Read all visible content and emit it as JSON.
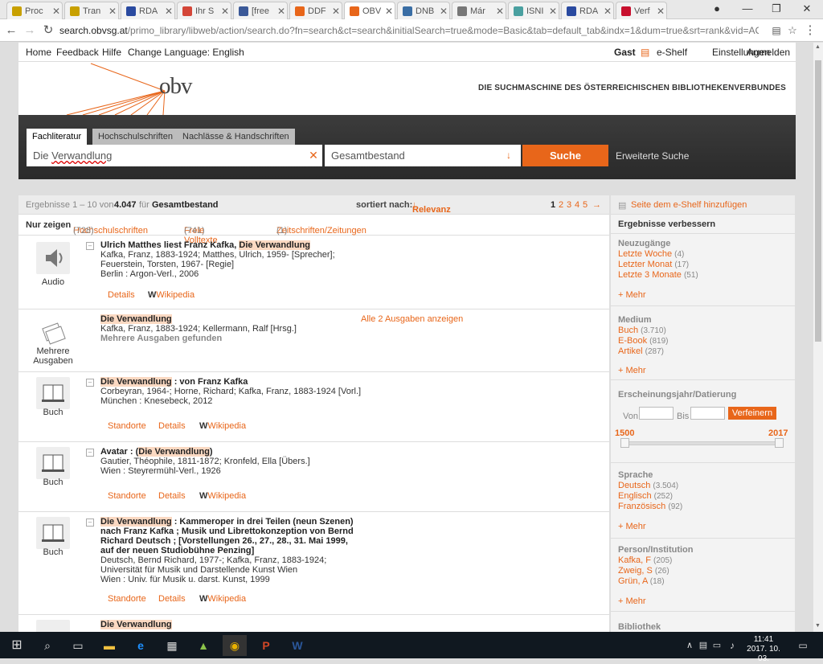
{
  "browser": {
    "tabs": [
      {
        "label": "Proc",
        "color": "#c8a000"
      },
      {
        "label": "Tran",
        "color": "#c8a000"
      },
      {
        "label": "RDA",
        "color": "#2a4aa0"
      },
      {
        "label": "Ihr S",
        "color": "#d44638"
      },
      {
        "label": "[free",
        "color": "#3b5998"
      },
      {
        "label": "DDF",
        "color": "#e8661a"
      },
      {
        "label": "OBV",
        "color": "#e8661a"
      },
      {
        "label": "DNB",
        "color": "#3a6ea5"
      },
      {
        "label": "Már",
        "color": "#777777"
      },
      {
        "label": "ISNI",
        "color": "#4aa0a0"
      },
      {
        "label": "RDA",
        "color": "#2a4aa0"
      },
      {
        "label": "Verf",
        "color": "#c8102e"
      }
    ],
    "close_glyph": "✕",
    "url_host": "search.obvsg.at",
    "url_path": "/primo_library/libweb/action/search.do?fn=search&ct=search&initialSearch=true&mode=Basic&tab=default_tab&indx=1&dum=true&srt=rank&vid=ACC..."
  },
  "topnav": {
    "home": "Home",
    "feedback": "Feedback",
    "help": "Hilfe",
    "lang": "Change Language: English",
    "guest": "Gast",
    "eshelf": "e-Shelf",
    "settings": "Einstellungen",
    "login": "Anmelden"
  },
  "banner": {
    "logo": "obv",
    "tagline": "DIE SUCHMASCHINE DES ÖSTERREICHISCHEN BIBLIOTHEKENVERBUNDES"
  },
  "search": {
    "tabs": [
      "Fachliteratur",
      "Hochschulschriften",
      "Nachlässe & Handschriften"
    ],
    "query_prefix": "Die ",
    "query_word": "Verwandlung",
    "clear_glyph": "✕",
    "scope": "Gesamtbestand",
    "scope_arrow": "↓",
    "button": "Suche",
    "advanced": "Erweiterte Suche"
  },
  "results_header": {
    "range": "Ergebnisse 1 – 10 von",
    "total": "4.047",
    "for": "für",
    "scope": "Gesamtbestand",
    "sort_label": "sortiert nach:",
    "sort_value": "Relevanz",
    "pages": [
      "1",
      "2",
      "3",
      "4",
      "5"
    ],
    "next": "→"
  },
  "filters": {
    "label": "Nur zeigen",
    "items": [
      {
        "name": "Hochschulschriften",
        "count": "(728)"
      },
      {
        "name": "Freie Volltexte",
        "count": "(741)"
      },
      {
        "name": "Zeitschriften/Zeitungen",
        "count": "(1)"
      }
    ]
  },
  "records": [
    {
      "type": "Audio",
      "title_pre": "Ulrich Matthes liest Franz Kafka, ",
      "title_hl": "Die Verwandlung",
      "title_post": "",
      "lines": [
        "Kafka, Franz, 1883-1924; Matthes, Ulrich, 1959- [Sprecher];",
        "Feuerstein, Torsten, 1967- [Regie]",
        "Berlin : Argon-Verl., 2006"
      ],
      "links": [
        "Details",
        "Wikipedia"
      ]
    },
    {
      "type": "Mehrere Ausgaben",
      "title_pre": "",
      "title_hl": "Die Verwandlung",
      "title_post": "",
      "lines": [
        "Kafka, Franz, 1883-1924; Kellermann, Ralf [Hrsg.]"
      ],
      "note": "Mehrere Ausgaben gefunden",
      "versions": "Alle 2 Ausgaben anzeigen",
      "links": []
    },
    {
      "type": "Buch",
      "title_pre": "",
      "title_hl": "Die Verwandlung",
      "title_post": " : von Franz Kafka",
      "lines": [
        "Corbeyran, 1964-; Horne, Richard; Kafka, Franz, 1883-1924 [Vorl.]",
        "München : Knesebeck, 2012"
      ],
      "links": [
        "Standorte",
        "Details",
        "Wikipedia"
      ]
    },
    {
      "type": "Buch",
      "title_pre": "Avatar : (",
      "title_hl": "Die Verwandlung",
      "title_post": ")",
      "lines": [
        "Gautier, Théophile, 1811-1872; Kronfeld, Ella [Übers.]",
        "Wien : Steyrermühl-Verl., 1926"
      ],
      "links": [
        "Standorte",
        "Details",
        "Wikipedia"
      ]
    },
    {
      "type": "Buch",
      "title_pre": "",
      "title_hl": "Die Verwandlung",
      "title_post": " : Kammeroper in drei Teilen (neun Szenen) nach Franz Kafka ; Musik und Librettokonzeption von Bernd Richard Deutsch ; [Vorstellungen 26., 27., 28., 31. Mai 1999, auf der neuen Studiobühne Penzing]",
      "lines": [
        "Deutsch, Bernd Richard, 1977-; Kafka, Franz, 1883-1924; Universität für Musik und Darstellende Kunst Wien",
        "Wien : Univ. für Musik u. darst. Kunst, 1999"
      ],
      "links": [
        "Standorte",
        "Details",
        "Wikipedia"
      ]
    },
    {
      "type": "",
      "title_pre": "",
      "title_hl": "Die Verwandlung",
      "title_post": "",
      "lines": [],
      "links": []
    }
  ],
  "facets": {
    "add_page": "Seite dem e-Shelf hinzufügen",
    "refine": "Ergebnisse verbessern",
    "more": "+ Mehr",
    "new": {
      "title": "Neuzugänge",
      "items": [
        {
          "name": "Letzte Woche",
          "count": "(4)"
        },
        {
          "name": "Letzter Monat",
          "count": "(17)"
        },
        {
          "name": "Letzte 3 Monate",
          "count": "(51)"
        }
      ]
    },
    "medium": {
      "title": "Medium",
      "items": [
        {
          "name": "Buch",
          "count": "(3.710)"
        },
        {
          "name": "E-Book",
          "count": "(819)"
        },
        {
          "name": "Artikel",
          "count": "(287)"
        }
      ]
    },
    "year": {
      "title": "Erscheinungsjahr/Datierung",
      "from_label": "Von",
      "to_label": "Bis",
      "button": "Verfeinern",
      "min": "1500",
      "max": "2017"
    },
    "lang": {
      "title": "Sprache",
      "items": [
        {
          "name": "Deutsch",
          "count": "(3.504)"
        },
        {
          "name": "Englisch",
          "count": "(252)"
        },
        {
          "name": "Französisch",
          "count": "(92)"
        }
      ]
    },
    "person": {
      "title": "Person/Institution",
      "items": [
        {
          "name": "Kafka, F",
          "count": "(205)"
        },
        {
          "name": "Zweig, S",
          "count": "(26)"
        },
        {
          "name": "Grün, A",
          "count": "(18)"
        }
      ]
    },
    "library": {
      "title": "Bibliothek"
    }
  },
  "taskbar": {
    "time": "11:41",
    "date": "2017. 10. 03."
  }
}
